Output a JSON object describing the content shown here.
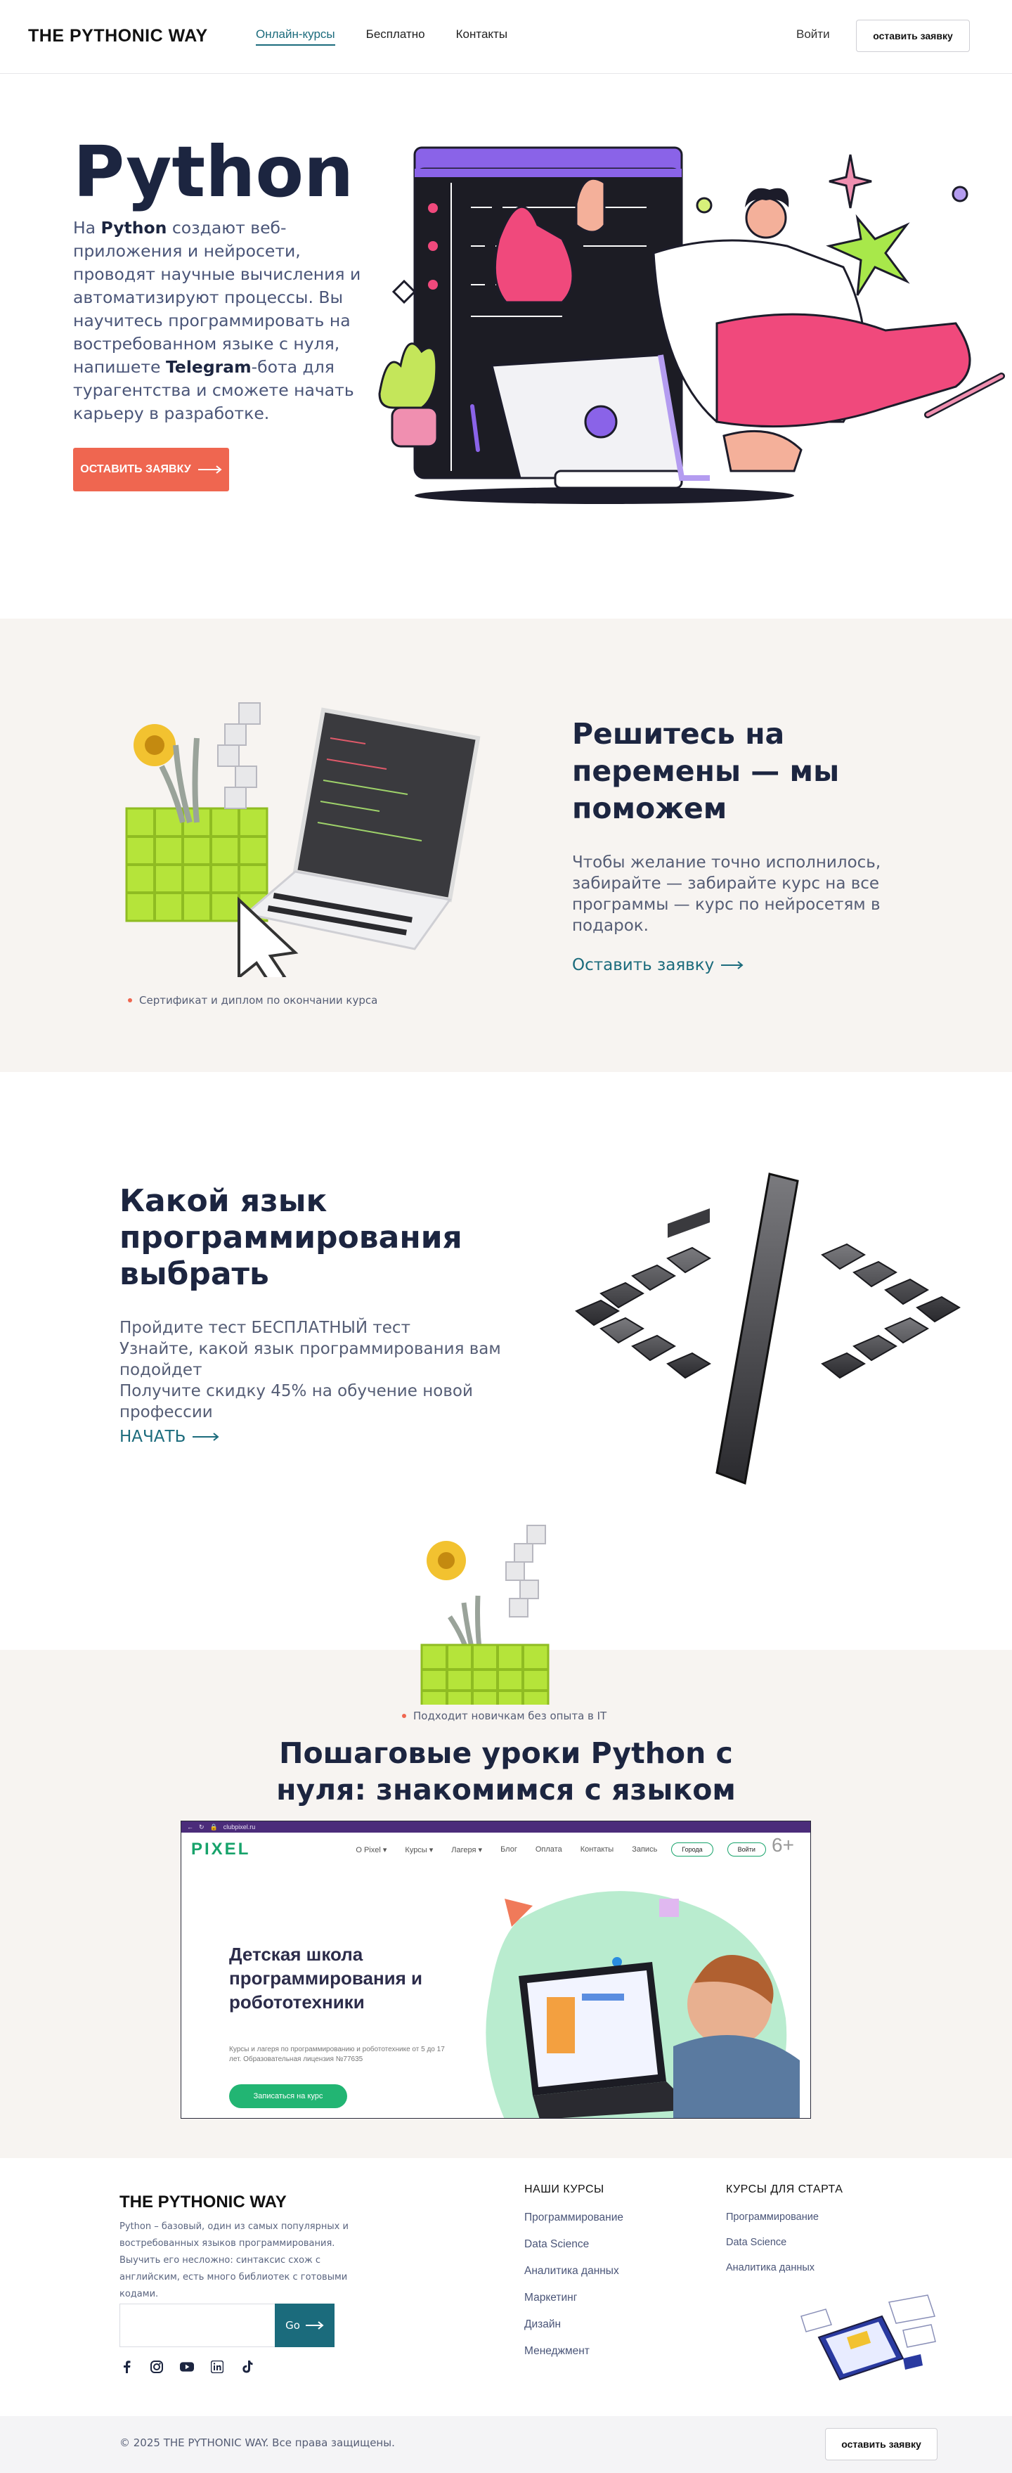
{
  "header": {
    "logo": "THE PYTHONIC WAY",
    "nav": [
      "Онлайн-курсы",
      "Бесплатно",
      "Контакты"
    ],
    "login": "Войти",
    "apply": "оставить заявку"
  },
  "hero": {
    "title": "Python",
    "text_parts": [
      "На ",
      "Python",
      " создают веб-приложения и нейросети, проводят научные вычисления и автоматизируют процессы. Вы научитесь программировать на востребованном языке с нуля, напишете ",
      "Telegram",
      "-бота для турагентства и сможете начать карьеру в разработке."
    ],
    "button": "ОСТАВИТЬ ЗАЯВКУ"
  },
  "decide": {
    "title": "Решитесь на перемены — мы поможем",
    "text": "Чтобы желание точно исполнилось, забирайте — забирайте курс на все программы — курс по нейросетям в подарок.",
    "link": "Оставить заявку",
    "note": "Сертификат и диплом по окончании курса"
  },
  "quiz": {
    "title": "Какой язык программирования выбрать",
    "lines": [
      "Пройдите тест БЕСПЛАТНЫЙ тест",
      "Узнайте, какой язык программирования вам подойдет",
      "Получите скидку 45% на обучение новой профессии"
    ],
    "link": "НАЧАТЬ"
  },
  "lessons": {
    "note": "Подходит новичкам без опыта в IT",
    "title_parts": [
      "Пошаговые уроки ",
      "Python",
      " с нуля: знакомимся с языком"
    ],
    "video": {
      "url": "clubpixel.ru",
      "logo": "PIXEL",
      "menu": [
        "О Pixel ▾",
        "Курсы ▾",
        "Лагеря ▾",
        "Блог",
        "Оплата",
        "Контакты",
        "Запись"
      ],
      "btn1": "Города",
      "btn2": "Войти",
      "age": "6+",
      "title": "Детская школа программирования и робототехники",
      "subtitle": "Курсы и лагеря по программированию и робототехнике от 5 до 17 лет. Образовательная лицензия №77635",
      "cta": "Записаться на курс"
    }
  },
  "footer": {
    "logo": "THE PYTHONIC WAY",
    "description": "Python – базовый, один из самых популярных и востребованных языков программирования. Выучить его несложно: синтаксис схож с английским, есть много библиотек с готовыми кодами.",
    "input_placeholder": "",
    "go": "Go",
    "col1": {
      "title": "НАШИ КУРСЫ",
      "items": [
        "Программирование",
        "Data Science",
        "Аналитика данных",
        "Маркетинг",
        "Дизайн",
        "Менеджмент"
      ]
    },
    "col2": {
      "title": "КУРСЫ ДЛЯ СТАРТА",
      "items": [
        "Программирование",
        "Data Science",
        "Аналитика данных"
      ]
    },
    "socials": [
      "facebook-icon",
      "instagram-icon",
      "youtube-icon",
      "linkedin-icon",
      "tiktok-icon"
    ],
    "copyright": "© 2025 THE PYTHONIC WAY. Все права защищены.",
    "apply": "оставить заявку"
  },
  "colors": {
    "accent": "#ef6650",
    "teal": "#1b6b7c",
    "navy": "#1c2540",
    "beige": "#f7f4f1"
  }
}
